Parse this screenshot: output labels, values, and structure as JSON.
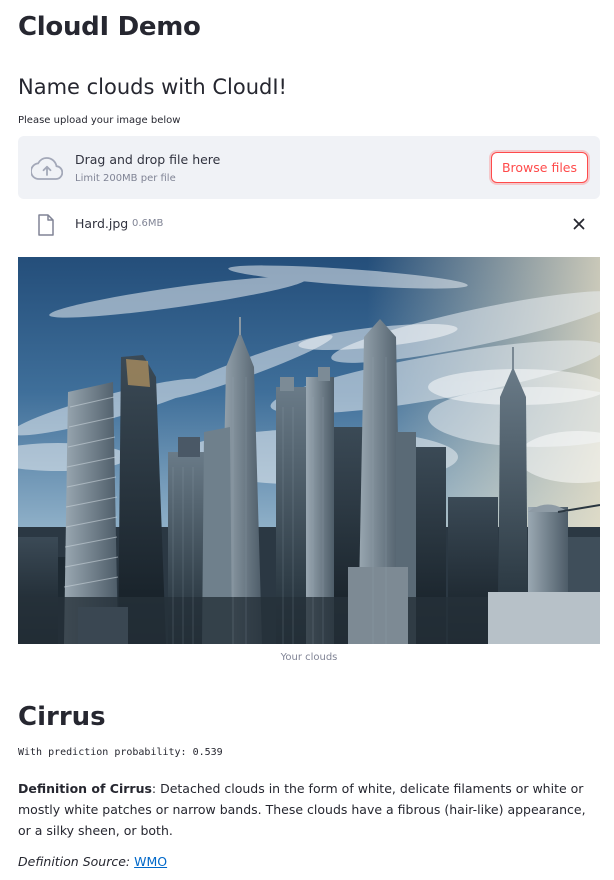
{
  "page": {
    "title": "CloudI Demo",
    "subtitle": "Name clouds with CloudI!"
  },
  "uploader": {
    "label": "Please upload your image below",
    "drop_text": "Drag and drop file here",
    "limit_text": "Limit 200MB per file",
    "browse_label": "Browse files",
    "cloud_icon": "cloud-upload-icon"
  },
  "file": {
    "name": "Hard.jpg",
    "size": "0.6MB",
    "file_icon": "file-icon",
    "remove_icon": "close-icon"
  },
  "image": {
    "caption": "Your clouds"
  },
  "result": {
    "label": "Cirrus",
    "probability_text": "With prediction probability: 0.539",
    "definition_term": "Definition of Cirrus",
    "definition_text": ": Detached clouds in the form of white, delicate filaments or white or mostly white patches or narrow bands. These clouds have a fibrous (hair-like) appearance, or a silky sheen, or both.",
    "source_label": "Definition Source:",
    "source_link": "WMO"
  },
  "colors": {
    "accent": "#ff4b4b",
    "link": "#0068c9",
    "dropzone_bg": "#f0f2f6",
    "text": "#262730",
    "muted": "#808495"
  }
}
